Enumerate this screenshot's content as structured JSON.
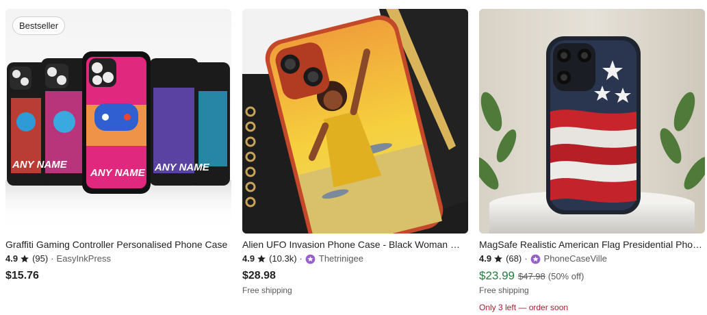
{
  "listings": [
    {
      "badge": "Bestseller",
      "title": "Graffiti Gaming Controller Personalised Phone Case",
      "rating": "4.9",
      "review_count": "(95)",
      "dot": "·",
      "shop": "EasyInkPress",
      "price": "$15.76",
      "case_text": "ANY NAME"
    },
    {
      "title": "Alien UFO Invasion Phone Case - Black Woman Retro Art",
      "rating": "4.9",
      "review_count": "(10.3k)",
      "dot": "·",
      "shop": "Thetrinigee",
      "price": "$28.98",
      "shipping": "Free shipping"
    },
    {
      "title": "MagSafe Realistic American Flag Presidential Phone Case",
      "rating": "4.9",
      "review_count": "(68)",
      "dot": "·",
      "shop": "PhoneCaseVille",
      "price": "$23.99",
      "original_price": "$47.98",
      "discount": "(50% off)",
      "shipping": "Free shipping",
      "stock_note": "Only 3 left — order soon"
    }
  ],
  "colors": {
    "text": "#222222",
    "muted": "#595959",
    "sale": "#257B3E",
    "urgency": "#A61A2E",
    "star_seller": "#9560C8"
  },
  "icons": [
    "star-icon",
    "star-seller-icon"
  ]
}
